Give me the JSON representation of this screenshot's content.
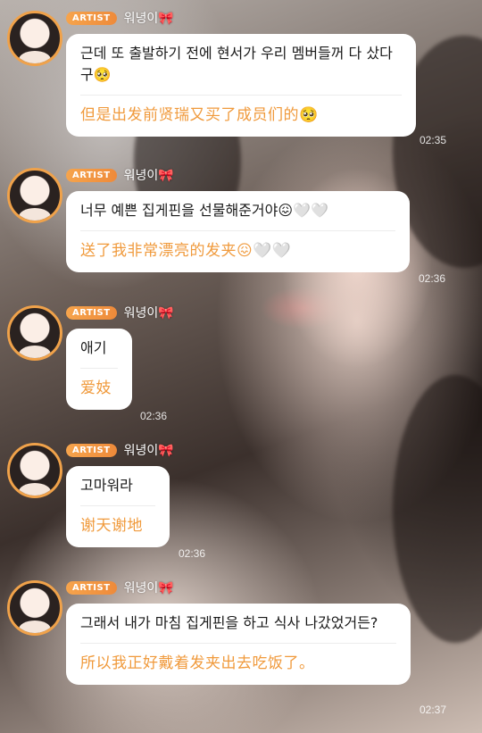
{
  "artist_badge": "ARTIST",
  "messages": [
    {
      "sender": "워녕이🎀",
      "korean": "근데 또 출발하기 전에 현서가 우리 멤버들꺼 다 샀다구🥺",
      "chinese": "但是出发前贤瑞又买了成员们的🥺",
      "time": "02:35"
    },
    {
      "sender": "워녕이🎀",
      "korean": "너무 예쁜 집게핀을 선물해준거야😖🤍🤍",
      "chinese": "送了我非常漂亮的发夹😖🤍🤍",
      "time": "02:36"
    },
    {
      "sender": "워녕이🎀",
      "korean": "애기",
      "chinese": "爱妓",
      "time": "02:36"
    },
    {
      "sender": "워녕이🎀",
      "korean": "고마워라",
      "chinese": "谢天谢地",
      "time": "02:36"
    },
    {
      "sender": "워녕이🎀",
      "korean": "그래서 내가 마침 집게핀을 하고 식사 나갔었거든?",
      "chinese": "所以我正好戴着发夹出去吃饭了。",
      "time": "02:37"
    }
  ]
}
